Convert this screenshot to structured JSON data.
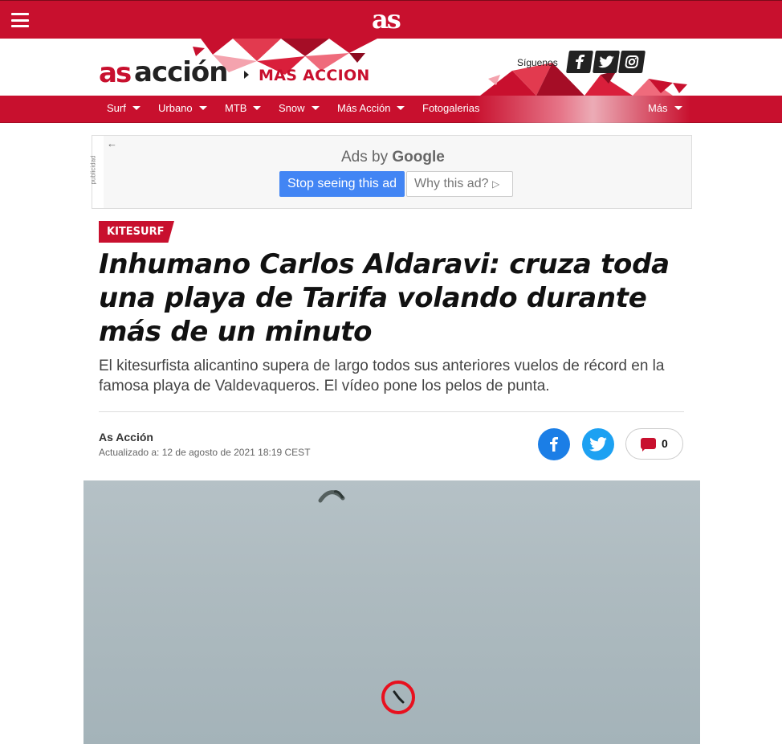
{
  "topbar": {
    "logo": "as",
    "menu_icon": "hamburger-icon"
  },
  "brand": {
    "as": "as",
    "accion": "acción",
    "section": "MAS ACCION",
    "follow_label": "Síguenos",
    "social": [
      {
        "name": "facebook-icon",
        "glyph": "f"
      },
      {
        "name": "twitter-icon",
        "glyph": "t"
      },
      {
        "name": "instagram-icon",
        "glyph": "ig"
      }
    ]
  },
  "nav": {
    "items": [
      {
        "label": "Surf",
        "dropdown": true
      },
      {
        "label": "Urbano",
        "dropdown": true
      },
      {
        "label": "MTB",
        "dropdown": true
      },
      {
        "label": "Snow",
        "dropdown": true
      },
      {
        "label": "Más Acción",
        "dropdown": true
      },
      {
        "label": "Fotogalerias",
        "dropdown": false
      }
    ],
    "more": "Más"
  },
  "ad": {
    "label": "publicidad",
    "ads_by": "Ads by",
    "google": "Google",
    "stop": "Stop seeing this ad",
    "why": "Why this ad?"
  },
  "article": {
    "tag": "KITESURF",
    "headline": "Inhumano Carlos Aldaravi: cruza toda una playa de Tarifa volando durante más de un minuto",
    "standfirst": "El kitesurfista alicantino supera de largo todos sus anteriores vuelos de récord en la famosa playa de Valdevaqueros. El vídeo pone los pelos de punta.",
    "author": "As Acción",
    "updated": "Actualizado a: 12 de agosto de 2021 18:19 CEST",
    "comments": "0"
  },
  "colors": {
    "brand_red": "#c8102e",
    "dark": "#222222",
    "facebook": "#1b7ee6",
    "twitter": "#1da1f2",
    "google_blue": "#4285f4"
  }
}
